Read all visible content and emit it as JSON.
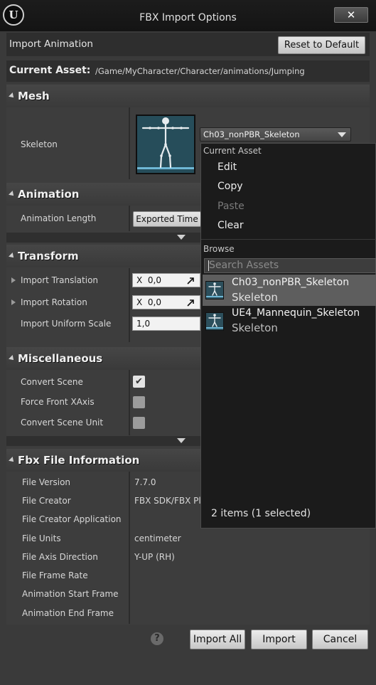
{
  "window": {
    "title": "FBX Import Options",
    "close_glyph": "✕",
    "logo_glyph": "U"
  },
  "header": {
    "import_type_label": "Import Animation",
    "reset_button": "Reset to Default",
    "current_asset_label": "Current Asset:",
    "current_asset_path": "/Game/MyCharacter/Character/animations/Jumping"
  },
  "sections": {
    "mesh": {
      "title": "Mesh",
      "skeleton_label": "Skeleton",
      "skeleton_value": "Ch03_nonPBR_Skeleton"
    },
    "animation": {
      "title": "Animation",
      "length_label": "Animation Length",
      "length_value": "Exported Time"
    },
    "transform": {
      "title": "Transform",
      "translation_label": "Import Translation",
      "translation_axis": "X",
      "translation_value": "0,0",
      "rotation_label": "Import Rotation",
      "rotation_axis": "X",
      "rotation_value": "0,0",
      "scale_label": "Import Uniform Scale",
      "scale_value": "1,0"
    },
    "misc": {
      "title": "Miscellaneous",
      "convert_scene_label": "Convert Scene",
      "convert_scene_checked": true,
      "force_front_label": "Force Front XAxis",
      "force_front_checked": false,
      "convert_unit_label": "Convert Scene Unit",
      "convert_unit_checked": false
    },
    "fbx_info": {
      "title": "Fbx File Information",
      "rows": [
        {
          "label": "File Version",
          "value": "7.7.0"
        },
        {
          "label": "File Creator",
          "value": "FBX SDK/FBX Pl"
        },
        {
          "label": "File Creator Application",
          "value": ""
        },
        {
          "label": "File Units",
          "value": "centimeter"
        },
        {
          "label": "File Axis Direction",
          "value": "Y-UP (RH)"
        },
        {
          "label": "File Frame Rate",
          "value": ""
        },
        {
          "label": "Animation Start Frame",
          "value": ""
        },
        {
          "label": "Animation End Frame",
          "value": ""
        }
      ]
    }
  },
  "dropdown": {
    "current_asset_heading": "Current Asset",
    "actions": [
      {
        "label": "Edit",
        "enabled": true
      },
      {
        "label": "Copy",
        "enabled": true
      },
      {
        "label": "Paste",
        "enabled": false
      },
      {
        "label": "Clear",
        "enabled": true
      }
    ],
    "browse_heading": "Browse",
    "search_placeholder": "Search Assets",
    "assets": [
      {
        "name": "Ch03_nonPBR_Skeleton",
        "type": "Skeleton",
        "selected": true
      },
      {
        "name": "UE4_Mannequin_Skeleton",
        "type": "Skeleton",
        "selected": false
      }
    ],
    "items_count": "2 items (1 selected)"
  },
  "footer": {
    "help_glyph": "?",
    "import_all": "Import All",
    "import": "Import",
    "cancel": "Cancel"
  },
  "colors": {
    "title_bar": "#171717",
    "panel": "#3d3d3d",
    "dropdown_bg": "#1b1b1b",
    "selected_row": "#5e5e5e",
    "thumbnail": "#264d5a"
  }
}
